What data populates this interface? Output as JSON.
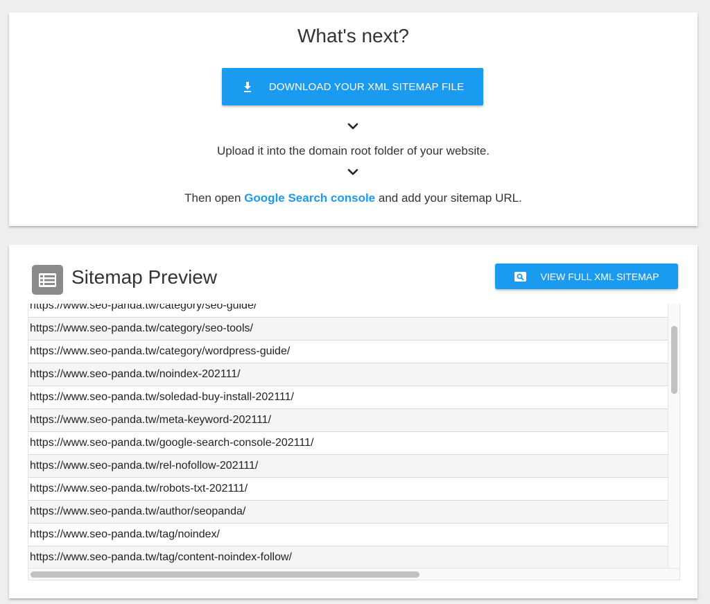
{
  "next": {
    "title": "What's next?",
    "download_label": "DOWNLOAD YOUR XML SITEMAP FILE",
    "download_icon": "download-icon",
    "step1": "Upload it into the domain root folder of your website.",
    "step2_prefix": "Then open ",
    "step2_link": "Google Search console",
    "step2_suffix": " and add your sitemap URL."
  },
  "preview": {
    "title": "Sitemap Preview",
    "icon": "list-icon",
    "view_label": "VIEW FULL XML SITEMAP",
    "view_icon": "search-icon",
    "urls": [
      "https://www.seo-panda.tw/category/seo-guide/",
      "https://www.seo-panda.tw/category/seo-tools/",
      "https://www.seo-panda.tw/category/wordpress-guide/",
      "https://www.seo-panda.tw/noindex-202111/",
      "https://www.seo-panda.tw/soledad-buy-install-202111/",
      "https://www.seo-panda.tw/meta-keyword-202111/",
      "https://www.seo-panda.tw/google-search-console-202111/",
      "https://www.seo-panda.tw/rel-nofollow-202111/",
      "https://www.seo-panda.tw/robots-txt-202111/",
      "https://www.seo-panda.tw/author/seopanda/",
      "https://www.seo-panda.tw/tag/noindex/",
      "https://www.seo-panda.tw/tag/content-noindex-follow/"
    ]
  },
  "colors": {
    "accent": "#1b9bf0",
    "background": "#eeeeee",
    "card": "#ffffff",
    "icon_gray": "#8a8a8a"
  }
}
